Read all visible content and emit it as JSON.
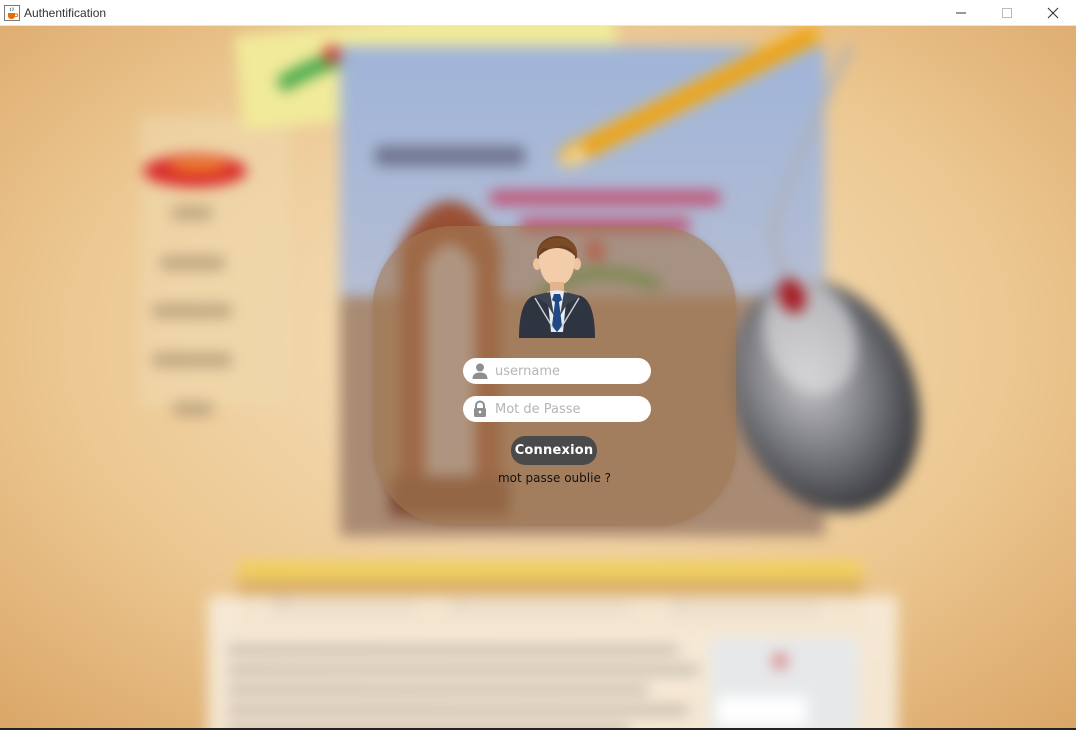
{
  "window": {
    "title": "Authentification",
    "icon": "java-cup-icon",
    "controls": [
      "minimize-icon",
      "maximize-icon",
      "close-icon"
    ]
  },
  "login": {
    "username_placeholder": "username",
    "username_value": "",
    "password_placeholder": "Mot de Passe",
    "password_value": "",
    "connect_label": "Connexion",
    "forgot_label": "mot passe oublie ?"
  },
  "colors": {
    "card_background": "#a07850",
    "button_background": "#4a4a4a",
    "field_background": "#ffffff",
    "scene_background": "#e9c48f"
  }
}
